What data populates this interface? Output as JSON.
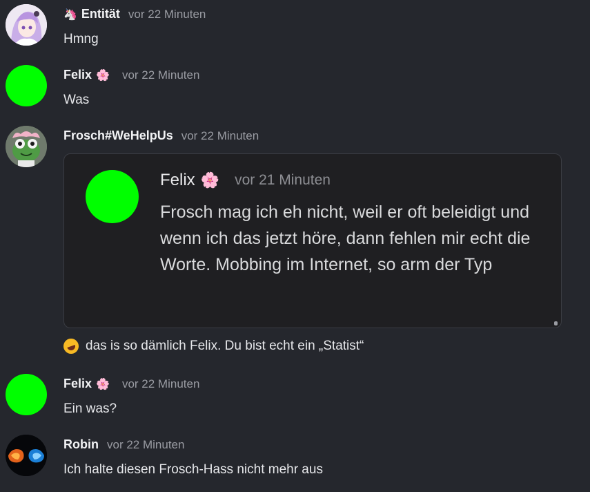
{
  "messages": [
    {
      "username": "Entität",
      "prefix_emoji": "🦄",
      "timestamp": "vor 22 Minuten",
      "text": "Hmng",
      "avatar": "anime-girl-avatar"
    },
    {
      "username": "Felix",
      "suffix_emoji": "🌸",
      "timestamp": "vor 22 Minuten",
      "text": "Was",
      "avatar_color": "#00ff00"
    },
    {
      "username": "Frosch#WeHelpUs",
      "timestamp": "vor 22 Minuten",
      "avatar": "frog-avatar",
      "embed": {
        "username": "Felix",
        "emoji": "🌸",
        "timestamp": "vor 21 Minuten",
        "text": "Frosch mag ich eh nicht, weil er oft beleidigt und wenn ich das jetzt höre, dann fehlen mir echt die Worte. Mobbing im Internet, so arm der Typ"
      },
      "reply_emoji": "rolling-on-floor-laughing",
      "reply_text": "das is so dämlich Felix. Du bist echt ein „Statist“"
    },
    {
      "username": "Felix",
      "suffix_emoji": "🌸",
      "timestamp": "vor 22 Minuten",
      "text": "Ein was?",
      "avatar_color": "#00ff00"
    },
    {
      "username": "Robin",
      "timestamp": "vor 22 Minuten",
      "text": "Ich halte diesen Frosch-Hass nicht mehr aus",
      "avatar": "fire-ice-fists-avatar"
    }
  ],
  "colors": {
    "background": "#25272d",
    "username": "#f2f3f5",
    "timestamp": "#9a9ca3",
    "text": "#e6e7ea",
    "embed_background": "#1f1f22",
    "green_avatar": "#00ff00"
  }
}
